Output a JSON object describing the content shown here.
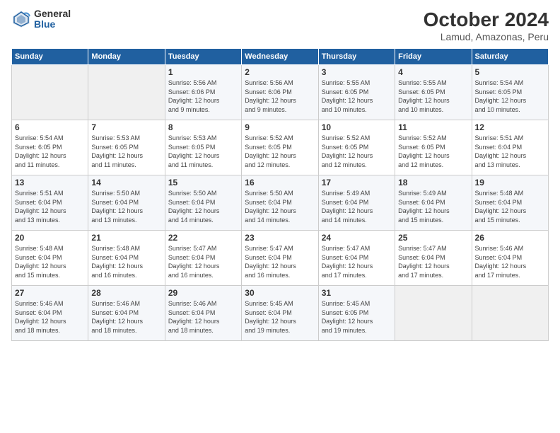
{
  "logo": {
    "general": "General",
    "blue": "Blue"
  },
  "title": "October 2024",
  "subtitle": "Lamud, Amazonas, Peru",
  "headers": [
    "Sunday",
    "Monday",
    "Tuesday",
    "Wednesday",
    "Thursday",
    "Friday",
    "Saturday"
  ],
  "weeks": [
    [
      {
        "day": "",
        "info": ""
      },
      {
        "day": "",
        "info": ""
      },
      {
        "day": "1",
        "info": "Sunrise: 5:56 AM\nSunset: 6:06 PM\nDaylight: 12 hours\nand 9 minutes."
      },
      {
        "day": "2",
        "info": "Sunrise: 5:56 AM\nSunset: 6:06 PM\nDaylight: 12 hours\nand 9 minutes."
      },
      {
        "day": "3",
        "info": "Sunrise: 5:55 AM\nSunset: 6:05 PM\nDaylight: 12 hours\nand 10 minutes."
      },
      {
        "day": "4",
        "info": "Sunrise: 5:55 AM\nSunset: 6:05 PM\nDaylight: 12 hours\nand 10 minutes."
      },
      {
        "day": "5",
        "info": "Sunrise: 5:54 AM\nSunset: 6:05 PM\nDaylight: 12 hours\nand 10 minutes."
      }
    ],
    [
      {
        "day": "6",
        "info": "Sunrise: 5:54 AM\nSunset: 6:05 PM\nDaylight: 12 hours\nand 11 minutes."
      },
      {
        "day": "7",
        "info": "Sunrise: 5:53 AM\nSunset: 6:05 PM\nDaylight: 12 hours\nand 11 minutes."
      },
      {
        "day": "8",
        "info": "Sunrise: 5:53 AM\nSunset: 6:05 PM\nDaylight: 12 hours\nand 11 minutes."
      },
      {
        "day": "9",
        "info": "Sunrise: 5:52 AM\nSunset: 6:05 PM\nDaylight: 12 hours\nand 12 minutes."
      },
      {
        "day": "10",
        "info": "Sunrise: 5:52 AM\nSunset: 6:05 PM\nDaylight: 12 hours\nand 12 minutes."
      },
      {
        "day": "11",
        "info": "Sunrise: 5:52 AM\nSunset: 6:05 PM\nDaylight: 12 hours\nand 12 minutes."
      },
      {
        "day": "12",
        "info": "Sunrise: 5:51 AM\nSunset: 6:04 PM\nDaylight: 12 hours\nand 13 minutes."
      }
    ],
    [
      {
        "day": "13",
        "info": "Sunrise: 5:51 AM\nSunset: 6:04 PM\nDaylight: 12 hours\nand 13 minutes."
      },
      {
        "day": "14",
        "info": "Sunrise: 5:50 AM\nSunset: 6:04 PM\nDaylight: 12 hours\nand 13 minutes."
      },
      {
        "day": "15",
        "info": "Sunrise: 5:50 AM\nSunset: 6:04 PM\nDaylight: 12 hours\nand 14 minutes."
      },
      {
        "day": "16",
        "info": "Sunrise: 5:50 AM\nSunset: 6:04 PM\nDaylight: 12 hours\nand 14 minutes."
      },
      {
        "day": "17",
        "info": "Sunrise: 5:49 AM\nSunset: 6:04 PM\nDaylight: 12 hours\nand 14 minutes."
      },
      {
        "day": "18",
        "info": "Sunrise: 5:49 AM\nSunset: 6:04 PM\nDaylight: 12 hours\nand 15 minutes."
      },
      {
        "day": "19",
        "info": "Sunrise: 5:48 AM\nSunset: 6:04 PM\nDaylight: 12 hours\nand 15 minutes."
      }
    ],
    [
      {
        "day": "20",
        "info": "Sunrise: 5:48 AM\nSunset: 6:04 PM\nDaylight: 12 hours\nand 15 minutes."
      },
      {
        "day": "21",
        "info": "Sunrise: 5:48 AM\nSunset: 6:04 PM\nDaylight: 12 hours\nand 16 minutes."
      },
      {
        "day": "22",
        "info": "Sunrise: 5:47 AM\nSunset: 6:04 PM\nDaylight: 12 hours\nand 16 minutes."
      },
      {
        "day": "23",
        "info": "Sunrise: 5:47 AM\nSunset: 6:04 PM\nDaylight: 12 hours\nand 16 minutes."
      },
      {
        "day": "24",
        "info": "Sunrise: 5:47 AM\nSunset: 6:04 PM\nDaylight: 12 hours\nand 17 minutes."
      },
      {
        "day": "25",
        "info": "Sunrise: 5:47 AM\nSunset: 6:04 PM\nDaylight: 12 hours\nand 17 minutes."
      },
      {
        "day": "26",
        "info": "Sunrise: 5:46 AM\nSunset: 6:04 PM\nDaylight: 12 hours\nand 17 minutes."
      }
    ],
    [
      {
        "day": "27",
        "info": "Sunrise: 5:46 AM\nSunset: 6:04 PM\nDaylight: 12 hours\nand 18 minutes."
      },
      {
        "day": "28",
        "info": "Sunrise: 5:46 AM\nSunset: 6:04 PM\nDaylight: 12 hours\nand 18 minutes."
      },
      {
        "day": "29",
        "info": "Sunrise: 5:46 AM\nSunset: 6:04 PM\nDaylight: 12 hours\nand 18 minutes."
      },
      {
        "day": "30",
        "info": "Sunrise: 5:45 AM\nSunset: 6:04 PM\nDaylight: 12 hours\nand 19 minutes."
      },
      {
        "day": "31",
        "info": "Sunrise: 5:45 AM\nSunset: 6:05 PM\nDaylight: 12 hours\nand 19 minutes."
      },
      {
        "day": "",
        "info": ""
      },
      {
        "day": "",
        "info": ""
      }
    ]
  ]
}
